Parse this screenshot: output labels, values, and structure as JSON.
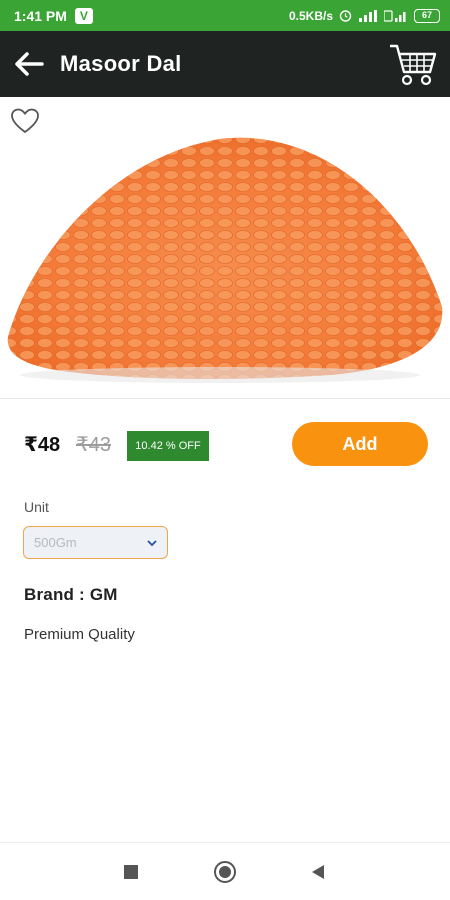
{
  "status_bar": {
    "time": "1:41 PM",
    "app_badge": "V",
    "net_speed": "0.5KB/s",
    "battery": "67"
  },
  "header": {
    "title": "Masoor Dal",
    "back_icon": "arrow-left-icon",
    "cart_icon": "shopping-cart-icon"
  },
  "product": {
    "favorite_icon": "heart-outline-icon",
    "price": "₹48",
    "mrp": "₹43",
    "discount": "10.42 % OFF",
    "add_label": "Add",
    "unit_label": "Unit",
    "unit_value": "500Gm",
    "brand": "Brand :  GM",
    "description": "Premium Quality"
  },
  "colors": {
    "status_bar": "#3aa535",
    "app_bar": "#1f2322",
    "accent": "#f9930f",
    "discount_bg": "#2f8a2f"
  },
  "nav": {
    "recents_icon": "square-icon",
    "home_icon": "circle-icon",
    "back_icon": "triangle-back-icon"
  }
}
